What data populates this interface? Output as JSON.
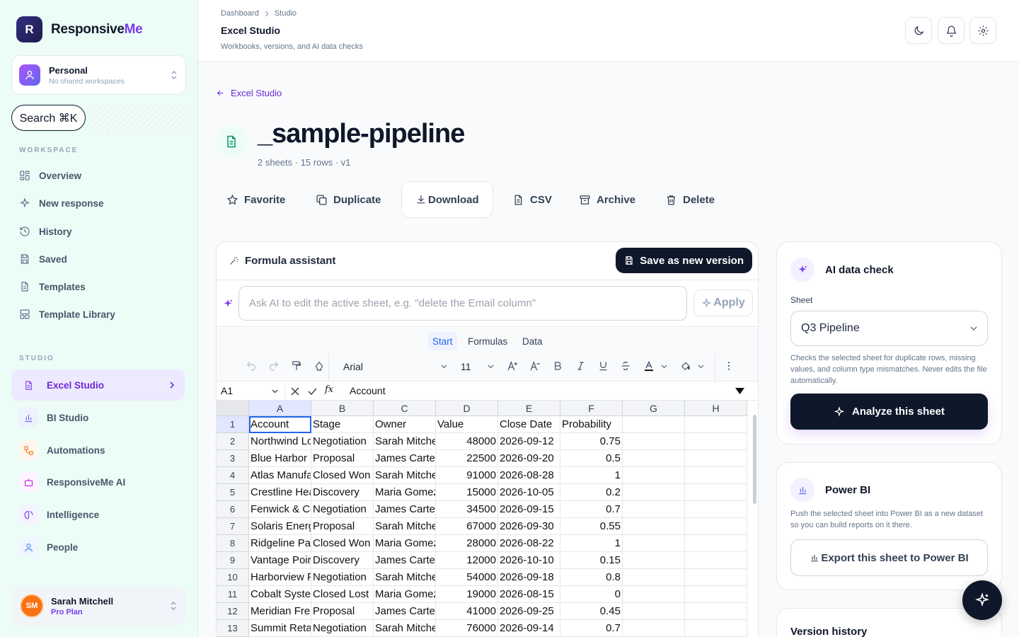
{
  "brand": {
    "initial": "R",
    "name_main": "Responsive",
    "name_accent": "Me"
  },
  "workspace": {
    "title": "Personal",
    "subtitle": "No shared workspaces"
  },
  "search": {
    "label": "Search ⌘K"
  },
  "sidebar": {
    "workspace_heading": "WORKSPACE",
    "items": [
      {
        "label": "Overview",
        "icon": "grid-icon"
      },
      {
        "label": "New response",
        "icon": "sparkles-icon"
      },
      {
        "label": "History",
        "icon": "history-icon"
      },
      {
        "label": "Saved",
        "icon": "save-icon"
      },
      {
        "label": "Templates",
        "icon": "file-icon"
      },
      {
        "label": "Template Library",
        "icon": "layout-icon"
      }
    ],
    "studio_heading": "STUDIO",
    "studio_items": [
      {
        "label": "Excel Studio",
        "icon": "spreadsheet-icon",
        "active": true
      },
      {
        "label": "BI Studio",
        "icon": "bar-chart-icon"
      },
      {
        "label": "Automations",
        "icon": "workflow-icon"
      },
      {
        "label": "ResponsiveMe AI",
        "icon": "bot-icon"
      },
      {
        "label": "Intelligence",
        "icon": "brain-icon"
      },
      {
        "label": "People",
        "icon": "user-icon"
      }
    ]
  },
  "user": {
    "initials": "SM",
    "name": "Sarah Mitchell",
    "plan": "Pro Plan"
  },
  "header": {
    "breadcrumb": [
      "Dashboard",
      "Studio"
    ],
    "title": "Excel Studio",
    "subtitle": "Workbooks, versions, and AI data checks"
  },
  "main": {
    "back_label": "Excel Studio",
    "doc_title": "_sample-pipeline",
    "doc_meta": "2 sheets · 15 rows · v1",
    "actions": [
      {
        "label": "Favorite",
        "icon": "star-icon"
      },
      {
        "label": "Duplicate",
        "icon": "copy-icon"
      },
      {
        "label": "Download",
        "icon": "download-icon"
      },
      {
        "label": "CSV",
        "icon": "file-text-icon"
      },
      {
        "label": "Archive",
        "icon": "archive-icon"
      },
      {
        "label": "Delete",
        "icon": "trash-icon"
      }
    ]
  },
  "formula_assistant": {
    "title": "Formula assistant",
    "save_label": "Save as new version",
    "ai_placeholder": "Ask AI to edit the active sheet, e.g. \"delete the Email column\"",
    "apply_label": "Apply"
  },
  "spreadsheet": {
    "ribbon_tabs": [
      "Start",
      "Formulas",
      "Data"
    ],
    "active_tab": "Start",
    "font": "Arial",
    "font_size": "11",
    "cell_ref": "A1",
    "formula_value": "Account",
    "columns": [
      "A",
      "B",
      "C",
      "D",
      "E",
      "F",
      "G",
      "H"
    ],
    "rows": [
      [
        "Account",
        "Stage",
        "Owner",
        "Value",
        "Close Date",
        "Probability"
      ],
      [
        "Northwind Lo",
        "Negotiation",
        "Sarah Mitche",
        "48000",
        "2026-09-12",
        "0.75"
      ],
      [
        "Blue Harbor I",
        "Proposal",
        "James Carte",
        "22500",
        "2026-09-20",
        "0.5"
      ],
      [
        "Atlas Manufa",
        "Closed Won",
        "Sarah Mitche",
        "91000",
        "2026-08-28",
        "1"
      ],
      [
        "Crestline Hea",
        "Discovery",
        "Maria Gomez",
        "15000",
        "2026-10-05",
        "0.2"
      ],
      [
        "Fenwick & Co",
        "Negotiation",
        "James Carte",
        "34500",
        "2026-09-15",
        "0.7"
      ],
      [
        "Solaris Energ",
        "Proposal",
        "Sarah Mitche",
        "67000",
        "2026-09-30",
        "0.55"
      ],
      [
        "Ridgeline Pa",
        "Closed Won",
        "Maria Gomez",
        "28000",
        "2026-08-22",
        "1"
      ],
      [
        "Vantage Poir",
        "Discovery",
        "James Carte",
        "12000",
        "2026-10-10",
        "0.15"
      ],
      [
        "Harborview F",
        "Negotiation",
        "Sarah Mitche",
        "54000",
        "2026-09-18",
        "0.8"
      ],
      [
        "Cobalt Syste",
        "Closed Lost",
        "Maria Gomez",
        "19000",
        "2026-08-15",
        "0"
      ],
      [
        "Meridian Frei",
        "Proposal",
        "James Carte",
        "41000",
        "2026-09-25",
        "0.45"
      ],
      [
        "Summit Reta",
        "Negotiation",
        "Sarah Mitche",
        "76000",
        "2026-09-14",
        "0.7"
      ]
    ]
  },
  "ai_check": {
    "title": "AI data check",
    "sheet_label": "Sheet",
    "sheet_value": "Q3 Pipeline",
    "description": "Checks the selected sheet for duplicate rows, missing values, and column type mismatches. Never edits the file automatically.",
    "button": "Analyze this sheet"
  },
  "power_bi": {
    "title": "Power BI",
    "description": "Push the selected sheet into Power BI as a new dataset so you can build reports on it there.",
    "button": "Export this sheet to Power BI"
  },
  "version_history": {
    "title": "Version history"
  },
  "colors": {
    "accent": "#7c3aed",
    "dark": "#0f172a",
    "sidebar_bg": "#ecfdf7",
    "link": "#2563eb"
  }
}
